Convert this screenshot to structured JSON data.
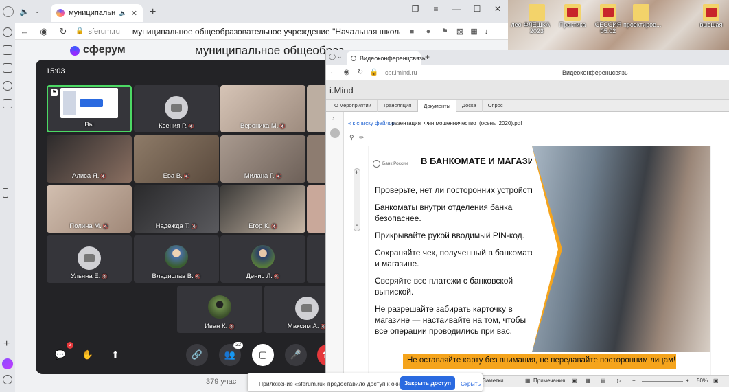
{
  "browser": {
    "tab_title": "муниципальное об",
    "domain": "sferum.ru",
    "page_title": "муниципальное общеобразовательное учреждение \"Начальная школа..."
  },
  "sferum": {
    "logo": "сферум",
    "org_name": "муниципальное общеобраз"
  },
  "desktop": {
    "icons": [
      {
        "label": "ФЛЕШКА 2023"
      },
      {
        "label": "Практика"
      },
      {
        "label": "СЕССИЯ 05.02"
      },
      {
        "label": "проектиров..."
      },
      {
        "label": "высшая"
      }
    ],
    "edge_label": "лео"
  },
  "call": {
    "time": "15:03",
    "participants": [
      {
        "name": "Вы"
      },
      {
        "name": "Ксения Р."
      },
      {
        "name": "Вероника М."
      },
      {
        "name": "Алиса Я."
      },
      {
        "name": "Ева В."
      },
      {
        "name": "Милана Г."
      },
      {
        "name": "Полина М."
      },
      {
        "name": "Надежда Т."
      },
      {
        "name": "Егор К."
      },
      {
        "name": "Ульяна Е."
      },
      {
        "name": "Владислав В."
      },
      {
        "name": "Денис Л."
      },
      {
        "name": "Иван К."
      },
      {
        "name": "Максим А."
      }
    ],
    "chat_badge": "2",
    "people_badge": "22",
    "participants_count": "379 учас"
  },
  "imind": {
    "tab_title": "Видеоконференцсвязь",
    "domain": "cbr.imind.ru",
    "page_title": "Видеоконференцсвязь",
    "brand": "i.Mind",
    "tabs": [
      "О мероприятии",
      "Трансляция",
      "Документы",
      "Доска",
      "Опрос"
    ],
    "back_link": "« к списку файлов",
    "file_name": "презентация_Фин.мошенничество_(осень_2020).pdf",
    "statusbar": {
      "notes": "Заметки",
      "comments": "Примечания",
      "zoom": "50%"
    }
  },
  "slide": {
    "bank": "Банк России",
    "title": "В БАНКОМАТЕ И МАГАЗИНЕ",
    "bullets": [
      "Проверьте, нет ли посторонних устройств.",
      "Банкоматы внутри отделения банка безопаснее.",
      "Прикрывайте рукой вводимый PIN-код.",
      "Сохраняйте чек, полученный в банкомате и магазине.",
      "Сверяйте все платежи с банковской выпиской.",
      "Не разрешайте забирать карточку в магазине — настаивайте на том, чтобы все операции проводились при вас."
    ],
    "footer": "Не оставляйте карту без внимания, не передавайте посторонним лицам!"
  },
  "permission": {
    "text": "Приложение «sferum.ru» предоставило доступ к окну.",
    "button": "Закрыть доступ",
    "hide": "Скрыть"
  },
  "colors": {
    "accent_blue": "#2a6ae0",
    "slide_orange": "#f5a41c",
    "call_bg": "#232326",
    "active_speaker": "#4cd964",
    "end_call": "#e5383b"
  }
}
